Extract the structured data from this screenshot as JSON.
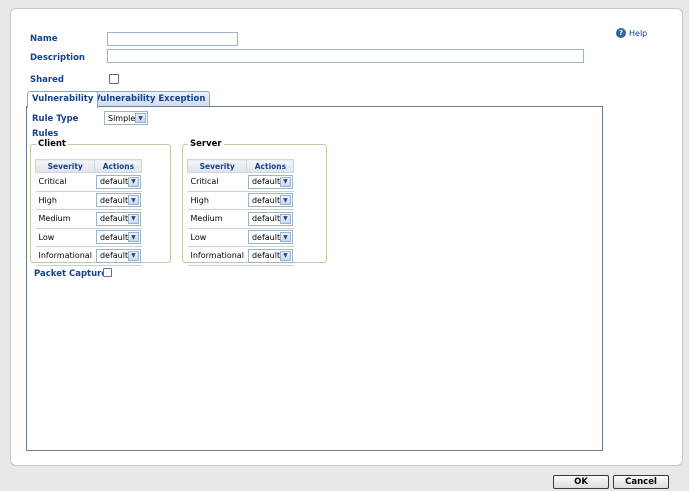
{
  "form": {
    "name_label": "Name",
    "name_value": "",
    "description_label": "Description",
    "description_value": "",
    "shared_label": "Shared",
    "shared_checked": false
  },
  "help": {
    "label": "Help",
    "icon": "help-icon"
  },
  "tabs": [
    {
      "label": "Vulnerability",
      "active": true
    },
    {
      "label": "Vulnerability Exception",
      "active": false
    }
  ],
  "panel": {
    "rule_type_label": "Rule Type",
    "rule_type_value": "Simple",
    "rules_label": "Rules",
    "client": {
      "title": "Client",
      "headers": [
        "Severity",
        "Actions"
      ],
      "rows": [
        {
          "severity": "Critical",
          "action": "default"
        },
        {
          "severity": "High",
          "action": "default"
        },
        {
          "severity": "Medium",
          "action": "default"
        },
        {
          "severity": "Low",
          "action": "default"
        },
        {
          "severity": "Informational",
          "action": "default"
        }
      ]
    },
    "server": {
      "title": "Server",
      "headers": [
        "Severity",
        "Actions"
      ],
      "rows": [
        {
          "severity": "Critical",
          "action": "default"
        },
        {
          "severity": "High",
          "action": "default"
        },
        {
          "severity": "Medium",
          "action": "default"
        },
        {
          "severity": "Low",
          "action": "default"
        },
        {
          "severity": "Informational",
          "action": "default"
        }
      ]
    },
    "packet_capture_label": "Packet Capture",
    "packet_capture_checked": false
  },
  "buttons": {
    "ok": "OK",
    "cancel": "Cancel"
  },
  "colors": {
    "label": "#15428b",
    "panel_border": "#6f7f93"
  }
}
